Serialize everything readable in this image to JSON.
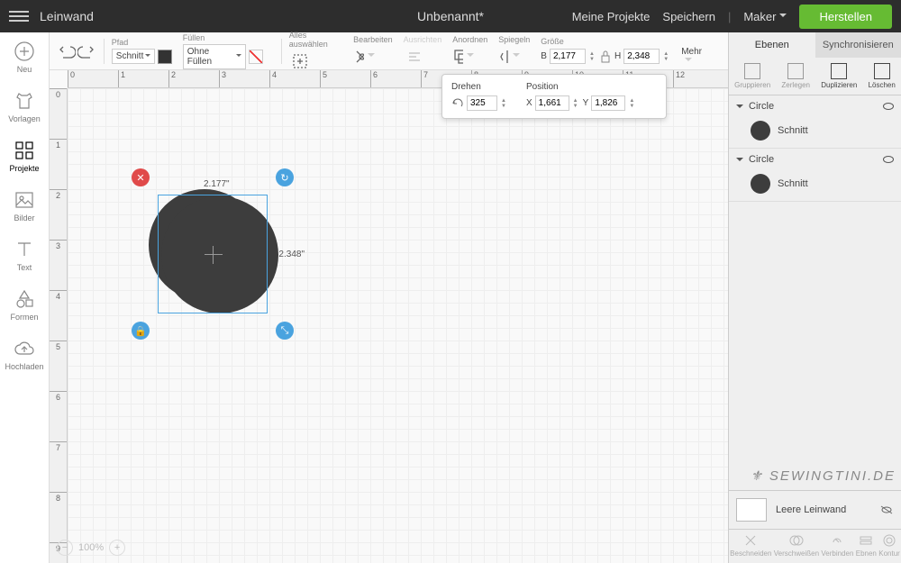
{
  "topbar": {
    "canvas_label": "Leinwand",
    "title": "Unbenannt*",
    "my_projects": "Meine Projekte",
    "save": "Speichern",
    "machine": "Maker",
    "make": "Herstellen"
  },
  "sidebar": {
    "items": [
      {
        "label": "Neu"
      },
      {
        "label": "Vorlagen"
      },
      {
        "label": "Projekte"
      },
      {
        "label": "Bilder"
      },
      {
        "label": "Text"
      },
      {
        "label": "Formen"
      },
      {
        "label": "Hochladen"
      }
    ]
  },
  "toolbar": {
    "path_label": "Pfad",
    "path_value": "Schnitt",
    "fill_label": "Füllen",
    "fill_value": "Ohne Füllen",
    "select_all": "Alles auswählen",
    "edit": "Bearbeiten",
    "align": "Ausrichten",
    "arrange": "Anordnen",
    "mirror": "Spiegeln",
    "size": "Größe",
    "size_w_lbl": "B",
    "size_w": "2,177",
    "size_h_lbl": "H",
    "size_h": "2,348",
    "more": "Mehr"
  },
  "popup": {
    "rotate_label": "Drehen",
    "rotate_value": "325",
    "position_label": "Position",
    "x_lbl": "X",
    "x_val": "1,661",
    "y_lbl": "Y",
    "y_val": "1,826"
  },
  "canvas": {
    "dim_w": "2.177\"",
    "dim_h": "2.348\"",
    "zoom": "100%",
    "h_ticks": [
      "0",
      "1",
      "2",
      "3",
      "4",
      "5",
      "6",
      "7",
      "8",
      "9",
      "10",
      "11",
      "12"
    ],
    "v_ticks": [
      "0",
      "1",
      "2",
      "3",
      "4",
      "5",
      "6",
      "7",
      "8",
      "9"
    ]
  },
  "rpanel": {
    "tab_layers": "Ebenen",
    "tab_sync": "Synchronisieren",
    "act_group": "Gruppieren",
    "act_ungroup": "Zerlegen",
    "act_dup": "Duplizieren",
    "act_del": "Löschen",
    "layers": [
      {
        "name": "Circle",
        "sub": "Schnitt"
      },
      {
        "name": "Circle",
        "sub": "Schnitt"
      }
    ],
    "blank": "Leere Leinwand",
    "foot": [
      "Beschneiden",
      "Verschweißen",
      "Verbinden",
      "Ebnen",
      "Kontur"
    ],
    "watermark": "SEWINGTINI.DE"
  }
}
